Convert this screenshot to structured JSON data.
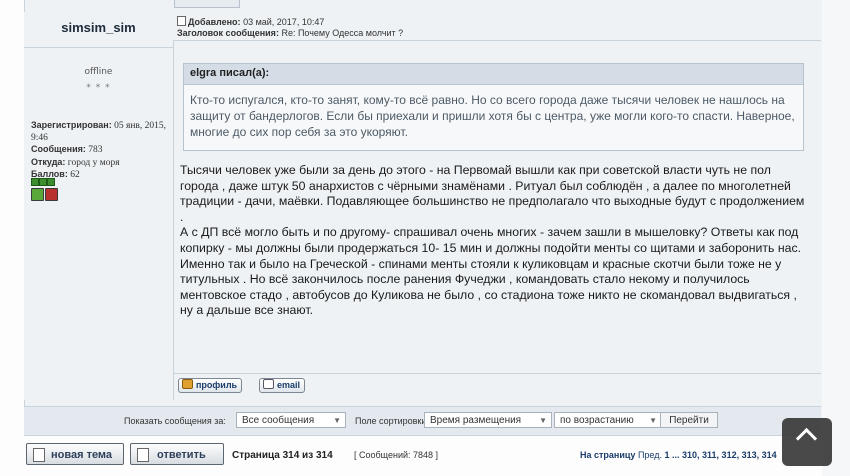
{
  "author": {
    "name": "simsim_sim",
    "status": "offline",
    "stars": "* * *",
    "registered_label": "Зарегистрирован:",
    "registered_value": "05 янв, 2015, 9:46",
    "posts_label": "Сообщения:",
    "posts_value": "783",
    "from_label": "Откуда:",
    "from_value": "город у моря",
    "points_label": "Баллов:",
    "points_value": "62"
  },
  "post": {
    "added_label": "Добавлено:",
    "added_value": "03 май, 2017, 10:47",
    "subject_label": "Заголовок сообщения:",
    "subject_value": "Re: Почему Одесса молчит ?",
    "quote_author": "elgra писал(а):",
    "quote_text": "Кто-то испугался, кто-то занят, кому-то всё равно. Но со всего города даже тысячи человек не нашлось на защиту от бандерлогов. Если бы приехали и пришли хотя бы с центра, уже могли кого-то спасти. Наверное, многие до сих пор себя за это укоряют.",
    "body": [
      "Тысячи человек уже были за день до этого - на Первомай вышли как при советской власти чуть не пол города , даже штук 50 анархистов с чёрными знамёнами . Ритуал был соблюдён , а далее по многолетней традиции - дачи, маёвки. Подавляющее большинство не предполагало что выходные будут с продолжением .",
      "А с ДП всё могло быть и по другому- спрашивал очень многих - зачем зашли в мышеловку? Ответы как под копирку - мы должны были продержаться 10- 15 мин и должны подойти менты со щитами и заборонить нас.",
      "Именно так и было на Греческой - спинами менты стояли к куликовцам и красные скотчи были тоже не у титульных . Но всё закончилось после ранения Фучеджи , командовать стало некому и получилось ментовское стадо , автобусов до Куликова не было , со стадиона тоже никто не скомандовал выдвигаться , ну а дальше все знают."
    ],
    "profile_button": "профиль",
    "email_button": "email"
  },
  "sort": {
    "show_label": "Показать сообщения за:",
    "show_value": "Все сообщения",
    "field_label": "Поле сортировки",
    "field_value": "Время размещения",
    "order_value": "по возрастанию",
    "go_button": "Перейти"
  },
  "footer": {
    "new_topic": "новая тема",
    "reply": "ответить",
    "page_info": "Страница 314 из 314",
    "message_count": "[ Сообщений: 7848 ]",
    "goto_label": "На страницу",
    "prev": "Пред.",
    "pages": "1 ... 310, 311, 312, 313, 314"
  },
  "icons": {
    "scroll_top": "chevron-up-icon",
    "online_badge": "green",
    "warn_badge": "red"
  }
}
